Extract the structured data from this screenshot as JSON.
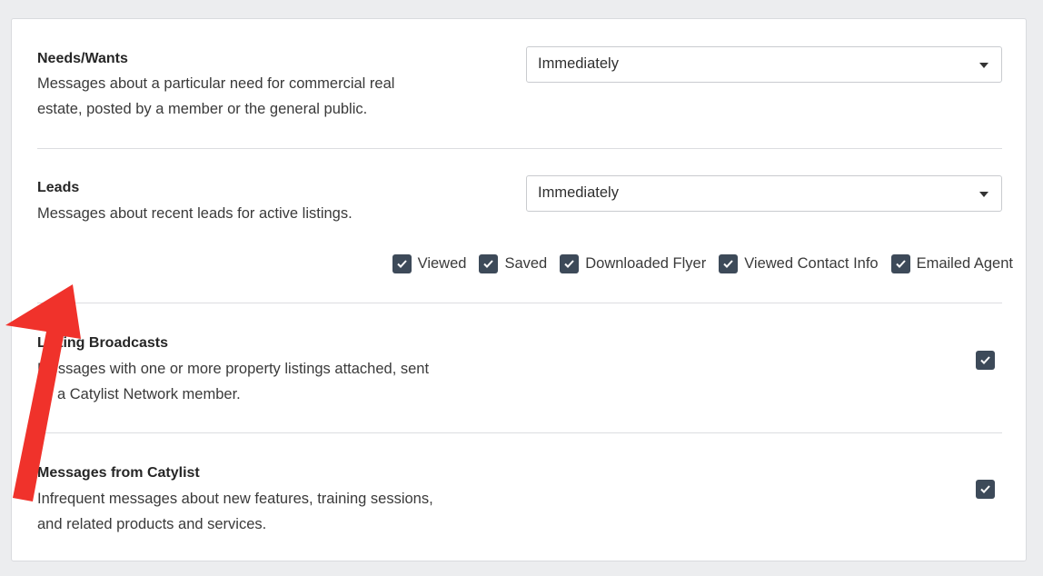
{
  "sections": [
    {
      "title": "Needs/Wants",
      "desc_line1": "Messages about a particular need for commercial real",
      "desc_line2": "estate, posted by a member or the general public.",
      "frequency": "Immediately"
    },
    {
      "title": "Leads",
      "desc_line1": "Messages about recent leads for active listings.",
      "frequency": "Immediately",
      "options": [
        {
          "label": "Viewed",
          "checked": true
        },
        {
          "label": "Saved",
          "checked": true
        },
        {
          "label": "Downloaded Flyer",
          "checked": true
        },
        {
          "label": "Viewed Contact Info",
          "checked": true
        },
        {
          "label": "Emailed Agent",
          "checked": true
        }
      ]
    },
    {
      "title": "Listing Broadcasts",
      "desc_line1": "Messages with one or more property listings attached, sent",
      "desc_line2": "by a Catylist Network member.",
      "checked": true
    },
    {
      "title": "Messages from Catylist",
      "desc_line1": "Infrequent messages about new features, training sessions,",
      "desc_line2": "and related products and services.",
      "checked": true
    }
  ],
  "colors": {
    "checkbox": "#3d4a59",
    "arrow": "#f0322b",
    "background": "#ecedef"
  },
  "icons": {
    "checkmark": "check-icon",
    "dropdown": "caret-down-icon",
    "annotation": "red-arrow"
  }
}
